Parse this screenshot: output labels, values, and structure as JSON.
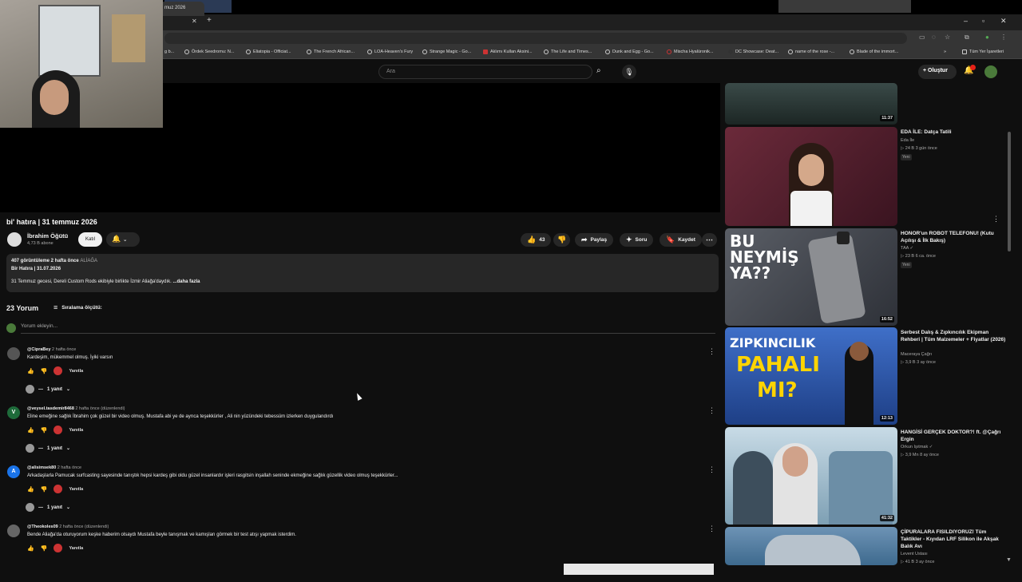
{
  "browser": {
    "tab_title": "muz 2026",
    "bookmarks": [
      "g b...",
      "Ördek Seedromu: N...",
      "Eliatopia - Officiat...",
      "The French African...",
      "LOA-Heaven's Fury",
      "Strange Magic - Go...",
      "Aklımı Kullan Aksini...",
      "The Life and Times...",
      "Dunk and Egg - Go...",
      "Mischa Hyalüronik...",
      "DC Showcase: Deat...",
      "name of the rose -...",
      "Blade of the immort..."
    ],
    "bookmarks_overflow": "»",
    "all_bookmarks": "Tüm Yer İşaretleri"
  },
  "yt_header": {
    "search_placeholder": "Ara",
    "create_label": "Oluştur"
  },
  "video": {
    "title": "bi' hatıra | 31 temmuz 2026",
    "channel": "İbrahim Öğütü",
    "subscribers": "4,73 B abone",
    "join_label": "Katıl",
    "likes": "43",
    "share": "Paylaş",
    "ask": "Soru",
    "save": "Kaydet",
    "views_time": "407 görüntüleme  2 hafta önce",
    "location_tag": "ALİAĞA",
    "desc_line2": "Bir Hatıra | 31.07.2026",
    "desc_line3": "31 Temmuz gecesi, Dereli Custom Rods ekibiyle birlikte İzmir Aliağa'daydık. ",
    "more": "...daha fazla"
  },
  "comments_section": {
    "count": "23 Yorum",
    "sort_label": "Sıralama ölçütü:",
    "add_placeholder": "Yorum ekleyin...",
    "reply_label": "Yanıtla",
    "replies_label": "1 yanıt",
    "items": [
      {
        "author": "@CipraBey",
        "time": "2 hafta önce",
        "text": "Kardeşim, mükemmel olmuş. İyiki varsın",
        "initial": "",
        "avatar_color": "#555555"
      },
      {
        "author": "@veysel.tasdemir8468",
        "time": "2 hafta önce (düzenlendi)",
        "text": "Eline emeğine sağlık İbrahim çok güzel bir video olmuş. Mustafa abi ye de ayrıca teşekkürler , Ali nin yüzündeki tebessüm izlerken duygulandırdı",
        "initial": "V",
        "avatar_color": "#1e6b3a"
      },
      {
        "author": "@alisimsek80",
        "time": "2 hafta önce",
        "text": "Arkadaşlarla Pamucak surfcasting sayesinde tanıştık hepsi kardeş gibi oldu güzel insanlardır işleri rasgitsin inşallah seninde ekmeğine sağlık güzellik video olmuş teşekkürler...",
        "initial": "A",
        "avatar_color": "#1a73e8"
      },
      {
        "author": "@Theokoles09",
        "time": "2 hafta önce (düzenlendi)",
        "text": "Bende Aliağa'da oturuyorum keşke haberim olsaydı Mustafa beyle tanışmak ve kamışları görmek bir test atışı yapmak isterdim.",
        "initial": "",
        "avatar_color": "#666666"
      }
    ]
  },
  "recommendations": [
    {
      "title": "",
      "channel": "",
      "meta": "",
      "duration": "11:37",
      "badge": ""
    },
    {
      "title": "EDA İLE: Datça Tatili",
      "channel": "Eda İle",
      "meta": "▷ 24 B  3 gün önce",
      "duration": "",
      "badge": "Yeni"
    },
    {
      "title": "HONOR'un ROBOT TELEFONU! (Kutu Açılışı & İlk Bakış)",
      "channel": "TAA",
      "meta": "▷ 23 B  6 ca. önce",
      "duration": "16:52",
      "badge": "Yeni",
      "thumb_text": "BU NEYMİŞ YA??"
    },
    {
      "title": "Serbest Dalış & Zıpkıncılık Ekipman Rehberi | Tüm Malzemeler + Fiyatlar (2026)",
      "channel": "Maceraya Çağrı",
      "meta": "▷ 3,9 B  3 ay önce",
      "duration": "12:13",
      "badge": "",
      "thumb_text_1": "ZIPKINCILIK",
      "thumb_text_2": "PAHALI",
      "thumb_text_3": "MI?"
    },
    {
      "title": "HANGİSİ GERÇEK DOKTOR?! ft. @Çağrı Ergin",
      "channel": "Orkun Işıtmak",
      "meta": "▷ 3,9 Mn  8 ay önce",
      "duration": "41:32",
      "badge": ""
    },
    {
      "title": "ÇİPURALARA FISILDIYORUZ! Tüm Taktikler - Kıyıdan LRF Silikon ile Akşak Balık Avı",
      "channel": "Levent Ustası",
      "meta": "▷ 41 B  3 ay önce",
      "duration": "",
      "badge": ""
    }
  ],
  "colors": {
    "accent": "#ff0000",
    "bg": "#0f0f0f",
    "surface": "#272727"
  }
}
